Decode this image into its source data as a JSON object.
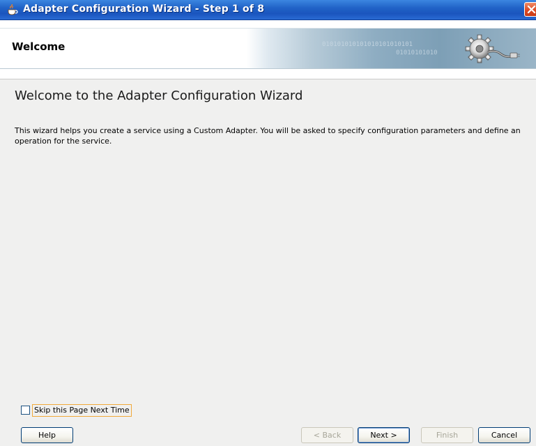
{
  "window": {
    "title": "Adapter Configuration Wizard - Step 1 of 8",
    "app_icon": "java-cup-icon",
    "close_icon": "close-icon"
  },
  "banner": {
    "title": "Welcome",
    "binary_text_1": "010101010101010101010101",
    "binary_text_2": "01010101010",
    "graphic_icon": "gear-plug-icon"
  },
  "content": {
    "heading": "Welcome to the Adapter Configuration Wizard",
    "description": "This wizard helps you create a service using a Custom Adapter. You will be asked to specify configuration parameters and define an operation for the service."
  },
  "options": {
    "skip_label": "Skip this Page Next Time",
    "skip_checked": false
  },
  "buttons": {
    "help": "Help",
    "back": "< Back",
    "next": "Next >",
    "finish": "Finish",
    "cancel": "Cancel"
  },
  "colors": {
    "titlebar": "#2163c7",
    "close": "#dd4a24",
    "window_bg": "#f0f0ef",
    "focus_outline": "#f0a93a"
  }
}
